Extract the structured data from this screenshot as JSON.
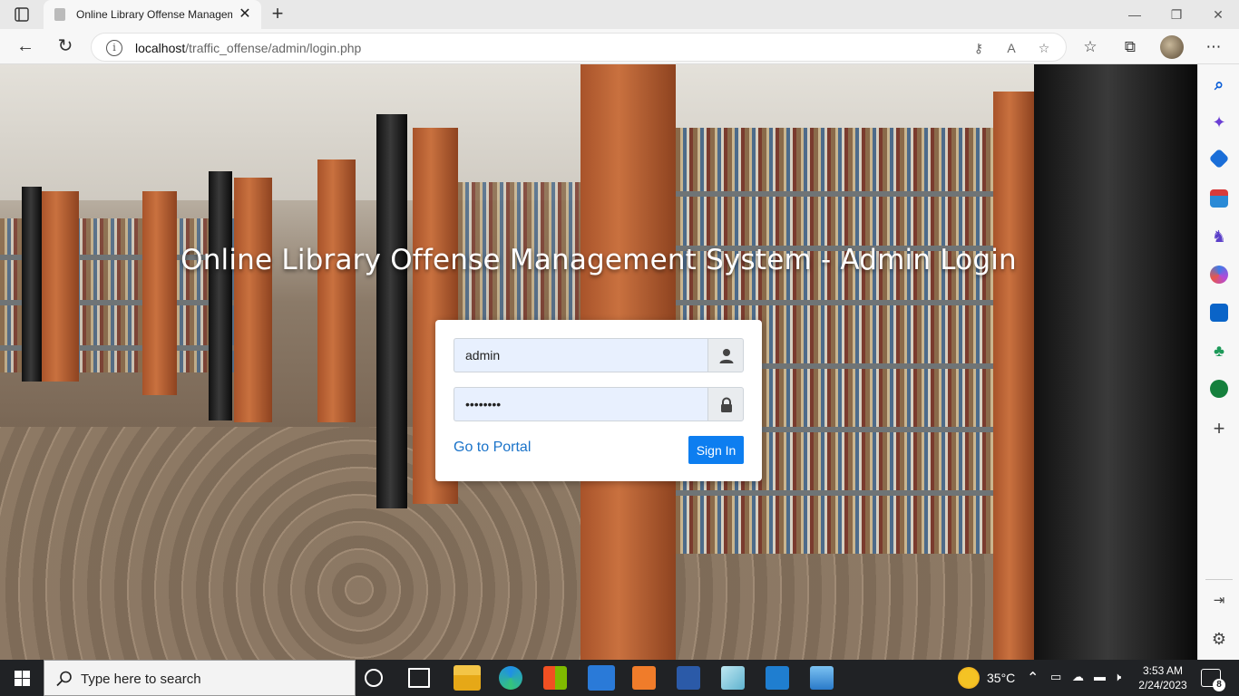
{
  "browser": {
    "tab_title": "Online Library Offense Managem",
    "url_host": "localhost",
    "url_path": "/traffic_offense/admin/login.php"
  },
  "page": {
    "heading": "Online Library Offense Management System - Admin Login",
    "username_value": "admin",
    "password_value": "password",
    "portal_link": "Go to Portal",
    "signin_label": "Sign In"
  },
  "sidebar_icons": [
    "search-icon",
    "copilot-icon",
    "shopping-icon",
    "tools-icon",
    "games-icon",
    "microsoft-365-icon",
    "outlook-icon",
    "tree-icon",
    "skype-icon",
    "add-icon"
  ],
  "taskbar": {
    "search_placeholder": "Type here to search",
    "temperature": "35°C",
    "time": "3:53 AM",
    "date": "2/24/2023",
    "notifications": "8"
  },
  "colors": {
    "signin_button": "#0d7ef0",
    "portal_link": "#1a73c9",
    "input_bg": "#e8f0fe"
  }
}
